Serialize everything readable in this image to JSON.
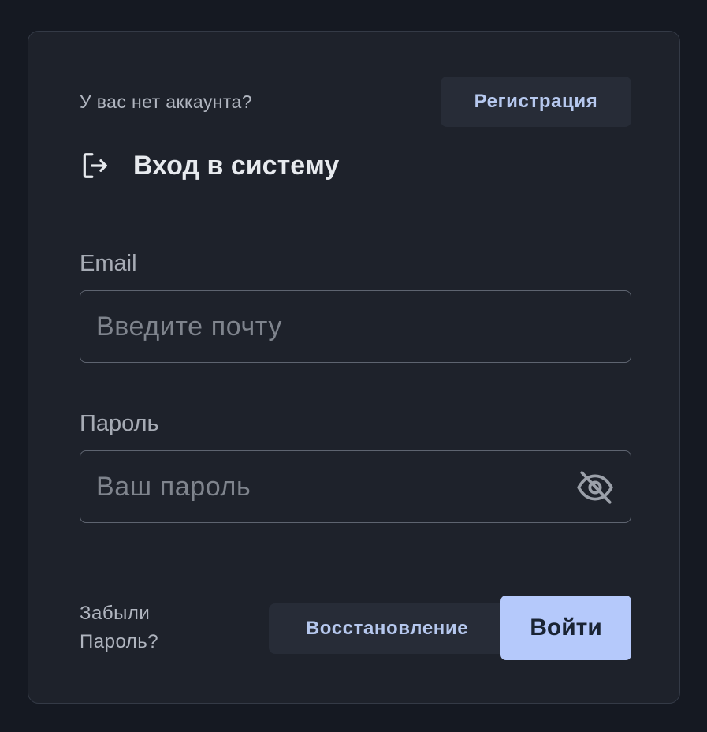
{
  "signup": {
    "prompt": "У вас нет аккаунта?",
    "button_label": "Регистрация"
  },
  "header": {
    "icon": "login-icon",
    "title": "Вход в систему"
  },
  "form": {
    "email": {
      "label": "Email",
      "value": "",
      "placeholder": "Введите почту"
    },
    "password": {
      "label": "Пароль",
      "value": "",
      "placeholder": "Ваш пароль",
      "toggle_icon": "eye-off-icon"
    }
  },
  "footer": {
    "forgot_line1": "Забыли",
    "forgot_line2": "Пароль?",
    "restore_label": "Восстановление",
    "submit_label": "Войти"
  },
  "colors": {
    "background": "#151922",
    "card": "#1e222b",
    "accent": "#b5c9fb",
    "secondary_button": "#272c37"
  }
}
